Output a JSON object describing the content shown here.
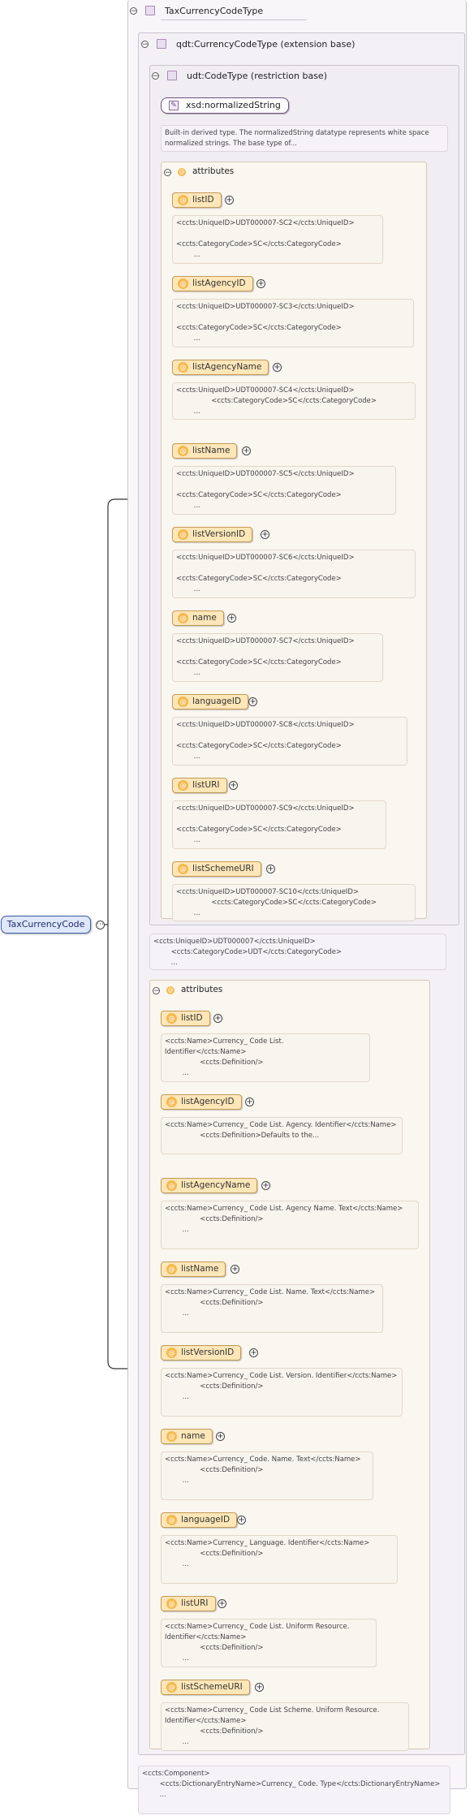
{
  "root": {
    "label": "TaxCurrencyCode"
  },
  "element_type": {
    "label": "TaxCurrencyCodeType"
  },
  "extension": {
    "label": "qdt:CurrencyCodeType (extension base)"
  },
  "restriction": {
    "label": "udt:CodeType (restriction base)"
  },
  "builtin": {
    "label": "xsd:normalizedString",
    "doc": "Built-in derived type. The normalizedString datatype represents white space normalized strings. The base type of..."
  },
  "inner_attributes": {
    "title": "attributes",
    "items": [
      {
        "name": "listID",
        "doc": "<ccts:UniqueID>UDT000007-SC2</ccts:UniqueID>\n\n<ccts:CategoryCode>SC</ccts:CategoryCode>\n        ..."
      },
      {
        "name": "listAgencyID",
        "doc": "<ccts:UniqueID>UDT000007-SC3</ccts:UniqueID>\n\n<ccts:CategoryCode>SC</ccts:CategoryCode>\n        ..."
      },
      {
        "name": "listAgencyName",
        "doc": "<ccts:UniqueID>UDT000007-SC4</ccts:UniqueID>\n                <ccts:CategoryCode>SC</ccts:CategoryCode>\n        ..."
      },
      {
        "name": "listName",
        "doc": "<ccts:UniqueID>UDT000007-SC5</ccts:UniqueID>\n\n<ccts:CategoryCode>SC</ccts:CategoryCode>\n        ..."
      },
      {
        "name": "listVersionID",
        "doc": "<ccts:UniqueID>UDT000007-SC6</ccts:UniqueID>\n\n<ccts:CategoryCode>SC</ccts:CategoryCode>\n        ..."
      },
      {
        "name": "name",
        "doc": "<ccts:UniqueID>UDT000007-SC7</ccts:UniqueID>\n\n<ccts:CategoryCode>SC</ccts:CategoryCode>\n        ..."
      },
      {
        "name": "languageID",
        "doc": "<ccts:UniqueID>UDT000007-SC8</ccts:UniqueID>\n\n<ccts:CategoryCode>SC</ccts:CategoryCode>\n        ..."
      },
      {
        "name": "listURI",
        "doc": "<ccts:UniqueID>UDT000007-SC9</ccts:UniqueID>\n\n<ccts:CategoryCode>SC</ccts:CategoryCode>\n        ..."
      },
      {
        "name": "listSchemeURI",
        "doc": "<ccts:UniqueID>UDT000007-SC10</ccts:UniqueID>\n                <ccts:CategoryCode>SC</ccts:CategoryCode>\n        ..."
      }
    ]
  },
  "restriction_doc": "<ccts:UniqueID>UDT000007</ccts:UniqueID>\n        <ccts:CategoryCode>UDT</ccts:CategoryCode>\n        ...",
  "outer_attributes": {
    "title": "attributes",
    "items": [
      {
        "name": "listID",
        "doc": "<ccts:Name>Currency_ Code List. Identifier</ccts:Name>\n                <ccts:Definition/>\n        ..."
      },
      {
        "name": "listAgencyID",
        "doc": "<ccts:Name>Currency_ Code List. Agency. Identifier</ccts:Name>\n                <ccts:Definition>Defaults to the..."
      },
      {
        "name": "listAgencyName",
        "doc": "<ccts:Name>Currency_ Code List. Agency Name. Text</ccts:Name>\n                <ccts:Definition/>\n        ..."
      },
      {
        "name": "listName",
        "doc": "<ccts:Name>Currency_ Code List. Name. Text</ccts:Name>\n                <ccts:Definition/>\n        ..."
      },
      {
        "name": "listVersionID",
        "doc": "<ccts:Name>Currency_ Code List. Version. Identifier</ccts:Name>\n                <ccts:Definition/>\n        ..."
      },
      {
        "name": "name",
        "doc": "<ccts:Name>Currency_ Code. Name. Text</ccts:Name>\n                <ccts:Definition/>\n        ..."
      },
      {
        "name": "languageID",
        "doc": "<ccts:Name>Currency_ Language. Identifier</ccts:Name>\n                <ccts:Definition/>\n        ..."
      },
      {
        "name": "listURI",
        "doc": "<ccts:Name>Currency_ Code List. Uniform Resource. Identifier</ccts:Name>\n                <ccts:Definition/>\n        ..."
      },
      {
        "name": "listSchemeURI",
        "doc": "<ccts:Name>Currency_ Code List Scheme. Uniform Resource. Identifier</ccts:Name>\n                <ccts:Definition/>\n        ..."
      }
    ]
  },
  "component_doc": "<ccts:Component>\n        <ccts:DictionaryEntryName>Currency_ Code. Type</ccts:DictionaryEntryName>\n        ...",
  "colors": {
    "root_fill": "#dfe8fb",
    "attribute_fill": "#fde6b8",
    "type_icon": "#e9def0"
  }
}
